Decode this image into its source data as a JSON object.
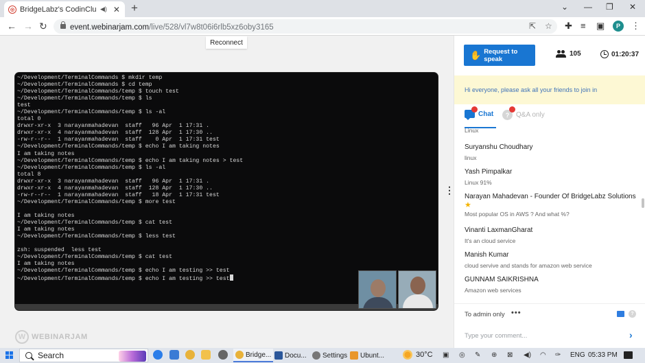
{
  "browser": {
    "tab_title": "BridgeLabz's CodinClub prog",
    "tab_audio_icon": "speaker-icon",
    "tab_close": "✕",
    "new_tab": "+",
    "url_host": "event.webinarjam.com",
    "url_path": "/live/528/vl7w8t06i6rlb5xz6oby3165",
    "profile_initial": "P"
  },
  "page": {
    "reconnect_label": "Reconnect",
    "logo_text": "WEBINARJAM"
  },
  "terminal": {
    "lines": [
      "~/Development/TerminalCommands $ mkdir temp",
      "~/Development/TerminalCommands $ cd temp",
      "~/Development/TerminalCommands/temp $ touch test",
      "~/Development/TerminalCommands/temp $ ls",
      "test",
      "~/Development/TerminalCommands/temp $ ls -al",
      "total 0",
      "drwxr-xr-x  3 narayanmahadevan  staff   96 Apr  1 17:31 .",
      "drwxr-xr-x  4 narayanmahadevan  staff  128 Apr  1 17:30 ..",
      "-rw-r--r--  1 narayanmahadevan  staff    0 Apr  1 17:31 test",
      "~/Development/TerminalCommands/temp $ echo I am taking notes",
      "I am taking notes",
      "~/Development/TerminalCommands/temp $ echo I am taking notes > test",
      "~/Development/TerminalCommands/temp $ ls -al",
      "total 8",
      "drwxr-xr-x  3 narayanmahadevan  staff   96 Apr  1 17:31 .",
      "drwxr-xr-x  4 narayanmahadevan  staff  128 Apr  1 17:30 ..",
      "-rw-r--r--  1 narayanmahadevan  staff   18 Apr  1 17:31 test",
      "~/Development/TerminalCommands/temp $ more test",
      "",
      "I am taking notes",
      "~/Development/TerminalCommands/temp $ cat test",
      "I am taking notes",
      "~/Development/TerminalCommands/temp $ less test",
      "",
      "zsh: suspended  less test",
      "~/Development/TerminalCommands/temp $ cat test",
      "I am taking notes",
      "~/Development/TerminalCommands/temp $ echo I am testing >> test",
      "~/Development/TerminalCommands/temp $ echo I am testing >> test"
    ]
  },
  "panel": {
    "request_label": "Request to speak",
    "attendee_count": "105",
    "timer": "01:20:37",
    "announcement": "Hi everyone, please ask all your friends to join in",
    "tab_chat": "Chat",
    "tab_qa": "Q&A only",
    "messages": [
      {
        "name": "",
        "text": "Linux"
      },
      {
        "name": "Suryanshu Choudhary",
        "text": "linux"
      },
      {
        "name": "Yash Pimpalkar",
        "text": "Linux 91%"
      },
      {
        "name": "Narayan Mahadevan - Founder Of BridgeLabz Solutions",
        "text": "Most popular OS in AWS ? And what %?"
      },
      {
        "name": "Vinanti LaxmanGharat",
        "text": "It's an cloud service"
      },
      {
        "name": "Manish Kumar",
        "text": "cloud servive and stands for amazon web service"
      },
      {
        "name": "GUNNAM SAIKRISHNA",
        "text": "Amazon web services"
      }
    ],
    "to_admin": "To admin only",
    "more": "•••",
    "comment_placeholder": "Type your comment..."
  },
  "taskbar": {
    "search_label": "Search",
    "tasks": [
      "Bridge...",
      "Docu...",
      "Settings",
      "Ubunt..."
    ],
    "temperature": "30°C",
    "language": "ENG",
    "time": "05:33 PM"
  },
  "colors": {
    "accent": "#1976d2",
    "announcement_bg": "#fdf8d4",
    "terminal_bg": "#0b0b0c"
  }
}
